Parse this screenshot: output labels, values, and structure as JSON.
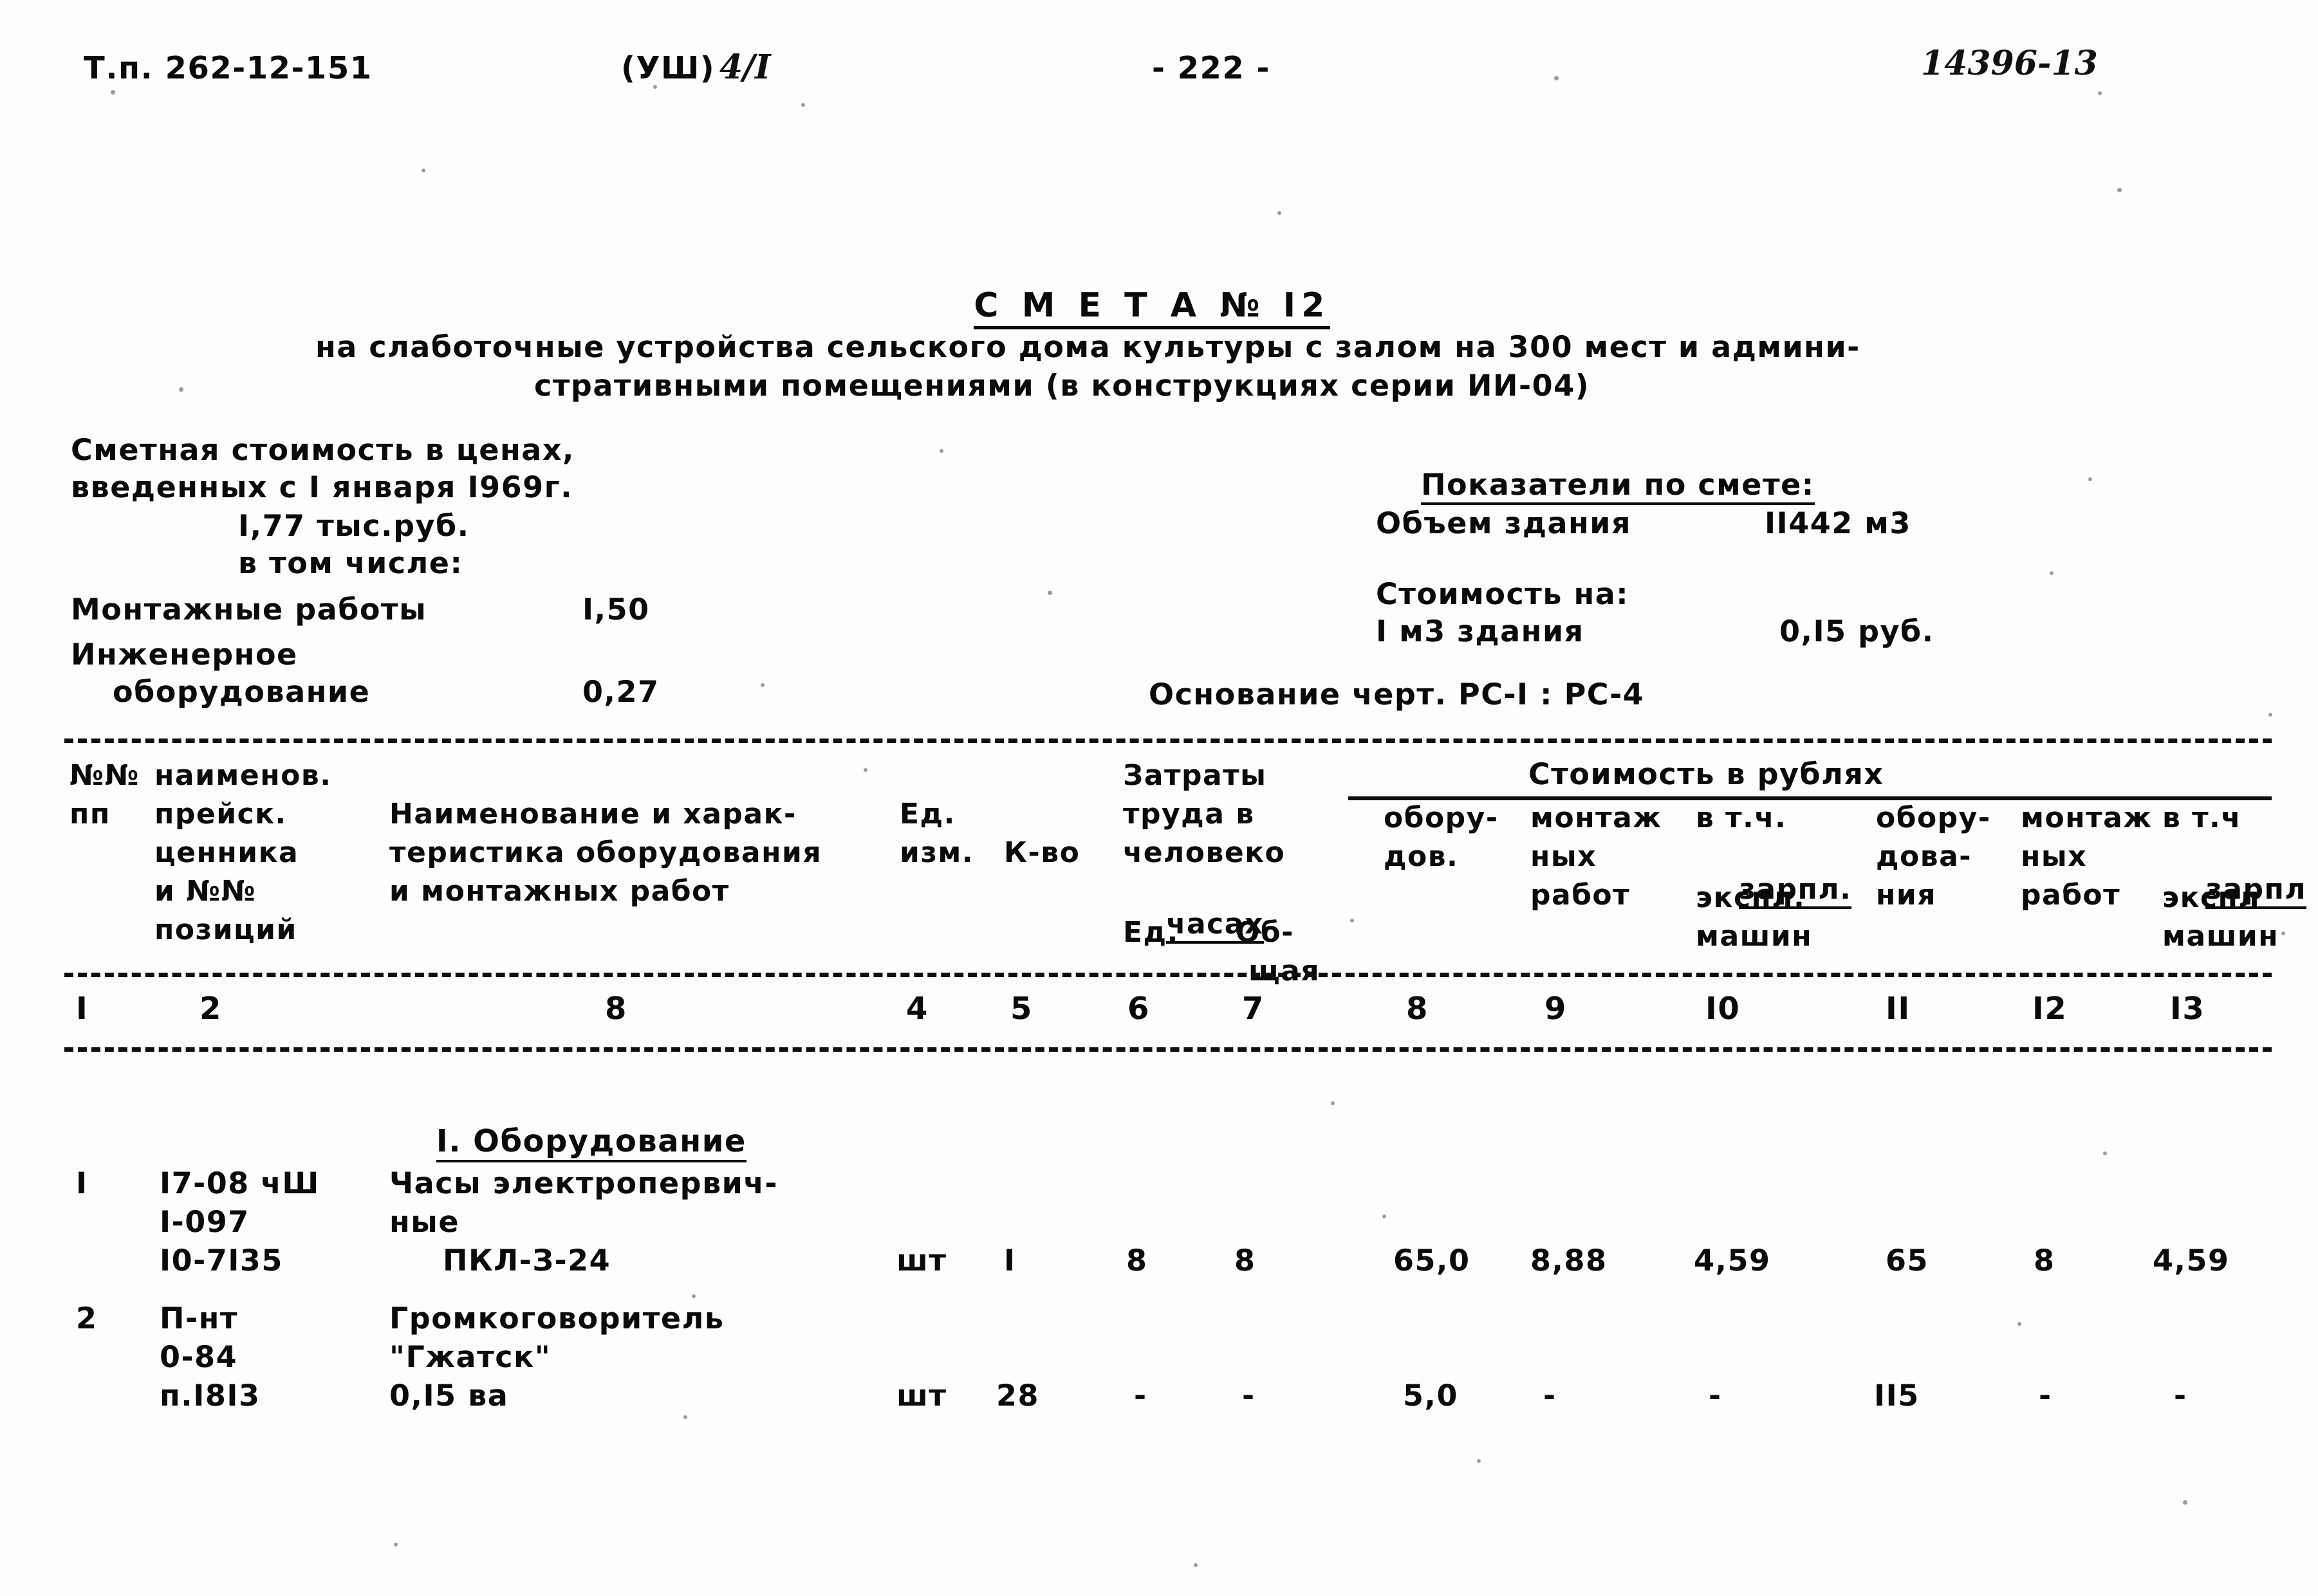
{
  "page": {
    "series_code": "Т.п. 262-12-151",
    "volume_mark": "(УШ)",
    "handwritten_volume": "4/I",
    "page_number": "- 222 -",
    "handwritten_code": "14396-13"
  },
  "title": {
    "heading": "С М Е Т А № I2",
    "subtitle_line1": "на слаботочные устройства сельского дома культуры с залом на 300 мест и админи-",
    "subtitle_line2": "стративными помещениями (в конструкциях серии ИИ-04)"
  },
  "cost_block": {
    "line1": "Сметная стоимость в ценах,",
    "line2": "введенных с I января I969г.",
    "total_value": "I,77 тыс.руб.",
    "including_label": "в том числе:",
    "rows": [
      {
        "label": "Монтажные работы",
        "value": "I,50"
      },
      {
        "label": "Инженерное",
        "label2": "оборудование",
        "value": "0,27"
      }
    ]
  },
  "indicators": {
    "heading": "Показатели по смете:",
    "volume_label": "Объем здания",
    "volume_value": "II442 м3",
    "cost_on_label": "Стоимость на:",
    "per_unit_label": "I м3 здания",
    "per_unit_value": "0,I5 руб.",
    "basis": "Основание черт. РС-I : РС-4"
  },
  "table": {
    "headers": {
      "c1": [
        "№№",
        "пп"
      ],
      "c2": [
        "наименов.",
        "прейск.",
        "ценника",
        "и №№",
        "позиций"
      ],
      "c3": [
        "Наименование и харак-",
        "теристика оборудования",
        "и монтажных работ"
      ],
      "c4": [
        "Ед.",
        "изм."
      ],
      "c5": [
        "К-во"
      ],
      "c6_7_group": [
        "Затраты",
        "труда в",
        "человеко",
        "часах"
      ],
      "c6": "Ед.",
      "c7": [
        "Об-",
        "щая"
      ],
      "money_group": "Стоимость в рублях",
      "c8": [
        "обору-",
        "дов."
      ],
      "c9": [
        "монтаж",
        "ных",
        "работ"
      ],
      "c10": [
        "в т.ч.",
        "зарпл.",
        "экспл.",
        "машин"
      ],
      "c11": [
        "обору-",
        "дова-",
        "ния"
      ],
      "c12": [
        "монтаж",
        "ных",
        "работ"
      ],
      "c13": [
        "в т.ч",
        "зарпл",
        "экспл",
        "машин"
      ]
    },
    "column_numbers": [
      "I",
      "2",
      "8",
      "4",
      "5",
      "6",
      "7",
      "8",
      "9",
      "I0",
      "II",
      "I2",
      "I3"
    ],
    "section_heading": "I. Оборудование",
    "rows": [
      {
        "num": "I",
        "price_ref": [
          "I7-08 чШ",
          "I-097",
          "I0-7I35"
        ],
        "name": [
          "Часы электропервич-",
          "ные",
          "ПКЛ-З-24"
        ],
        "unit": "шт",
        "qty": "I",
        "labor_unit": "8",
        "labor_total": "8",
        "equip_cost": "65,0",
        "install_cost": "8,88",
        "incl_salary": "4,59",
        "equip_total": "65",
        "install_total": "8",
        "incl_salary_total": "4,59"
      },
      {
        "num": "2",
        "price_ref": [
          "П-нт",
          "0-84",
          "п.I8I3"
        ],
        "name": [
          "Громкоговоритель",
          "\"Гжатск\"",
          "0,I5 ва"
        ],
        "unit": "шт",
        "qty": "28",
        "labor_unit": "-",
        "labor_total": "-",
        "equip_cost": "5,0",
        "install_cost": "-",
        "incl_salary": "-",
        "equip_total": "II5",
        "install_total": "-",
        "incl_salary_total": "-"
      }
    ]
  },
  "colors": {
    "ink": "#0a0a0a",
    "paper": "#fdfdfd"
  }
}
